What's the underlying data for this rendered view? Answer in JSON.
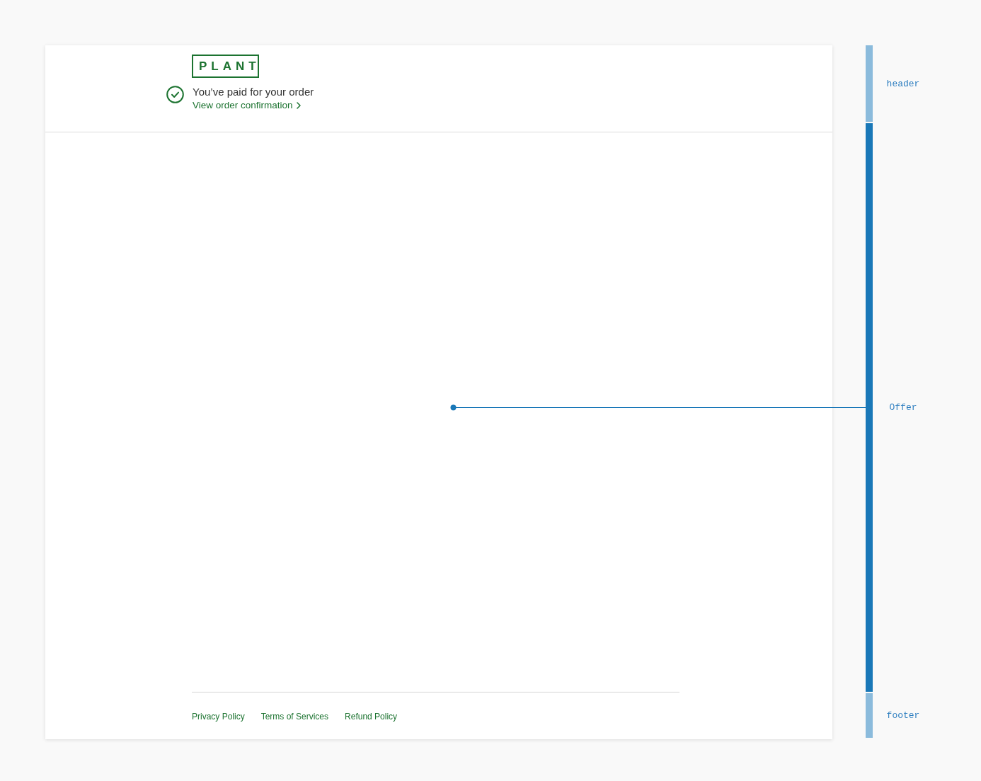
{
  "logo": {
    "text": "PLANT"
  },
  "status": {
    "title": "You’ve paid for your order",
    "link": "View order confirmation"
  },
  "footer": {
    "links": [
      "Privacy Policy",
      "Terms of Services",
      "Refund Policy"
    ]
  },
  "annotations": [
    {
      "label": "header",
      "selected": false
    },
    {
      "label": "Offer",
      "selected": true
    },
    {
      "label": "footer",
      "selected": false
    }
  ]
}
